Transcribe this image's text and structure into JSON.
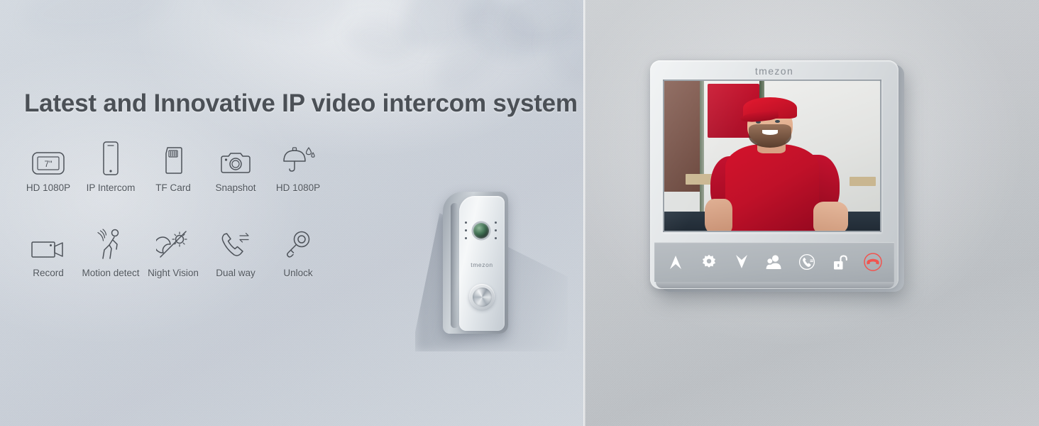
{
  "banner": {
    "headline": "Latest and Innovative IP video intercom system",
    "brand": "tmezon"
  },
  "features": {
    "row1": [
      {
        "label": "HD 1080P",
        "icon": "monitor-7-inch-icon",
        "badge": "7\""
      },
      {
        "label": "IP Intercom",
        "icon": "smartphone-icon"
      },
      {
        "label": "TF Card",
        "icon": "tf-card-icon"
      },
      {
        "label": "Snapshot",
        "icon": "camera-icon"
      },
      {
        "label": "HD 1080P",
        "icon": "umbrella-waterproof-icon"
      }
    ],
    "row2": [
      {
        "label": "Record",
        "icon": "video-camera-icon"
      },
      {
        "label": "Motion detect",
        "icon": "motion-detect-icon"
      },
      {
        "label": "Night Vision",
        "icon": "night-vision-icon"
      },
      {
        "label": "Dual way",
        "icon": "dual-way-talk-icon"
      },
      {
        "label": "Unlock",
        "icon": "key-unlock-icon"
      }
    ]
  },
  "door_station": {
    "brand": "tmezon",
    "name": "outdoor-door-station"
  },
  "monitor": {
    "brand": "tmezon",
    "controls": [
      {
        "name": "up-button",
        "icon": "chevron-up-icon"
      },
      {
        "name": "settings-button",
        "icon": "gear-icon"
      },
      {
        "name": "down-button",
        "icon": "chevron-down-icon"
      },
      {
        "name": "contacts-button",
        "icon": "person-icon"
      },
      {
        "name": "intercom-button",
        "icon": "call-icon"
      },
      {
        "name": "unlock-button",
        "icon": "padlock-open-icon"
      },
      {
        "name": "hangup-button",
        "icon": "hangup-icon"
      }
    ],
    "screen_caption": "Live video of a smiling delivery courier in a red cap and red t-shirt standing in front of a white truck"
  },
  "colors": {
    "headline": "#4b5056",
    "caption": "#50565d",
    "icon_stroke": "#4d5259",
    "left_wall": "#ccd2da",
    "right_wall": "#c4c7cb",
    "accent_red": "#c9112b",
    "hangup_red": "#f1544f",
    "control_white": "#ffffff"
  }
}
